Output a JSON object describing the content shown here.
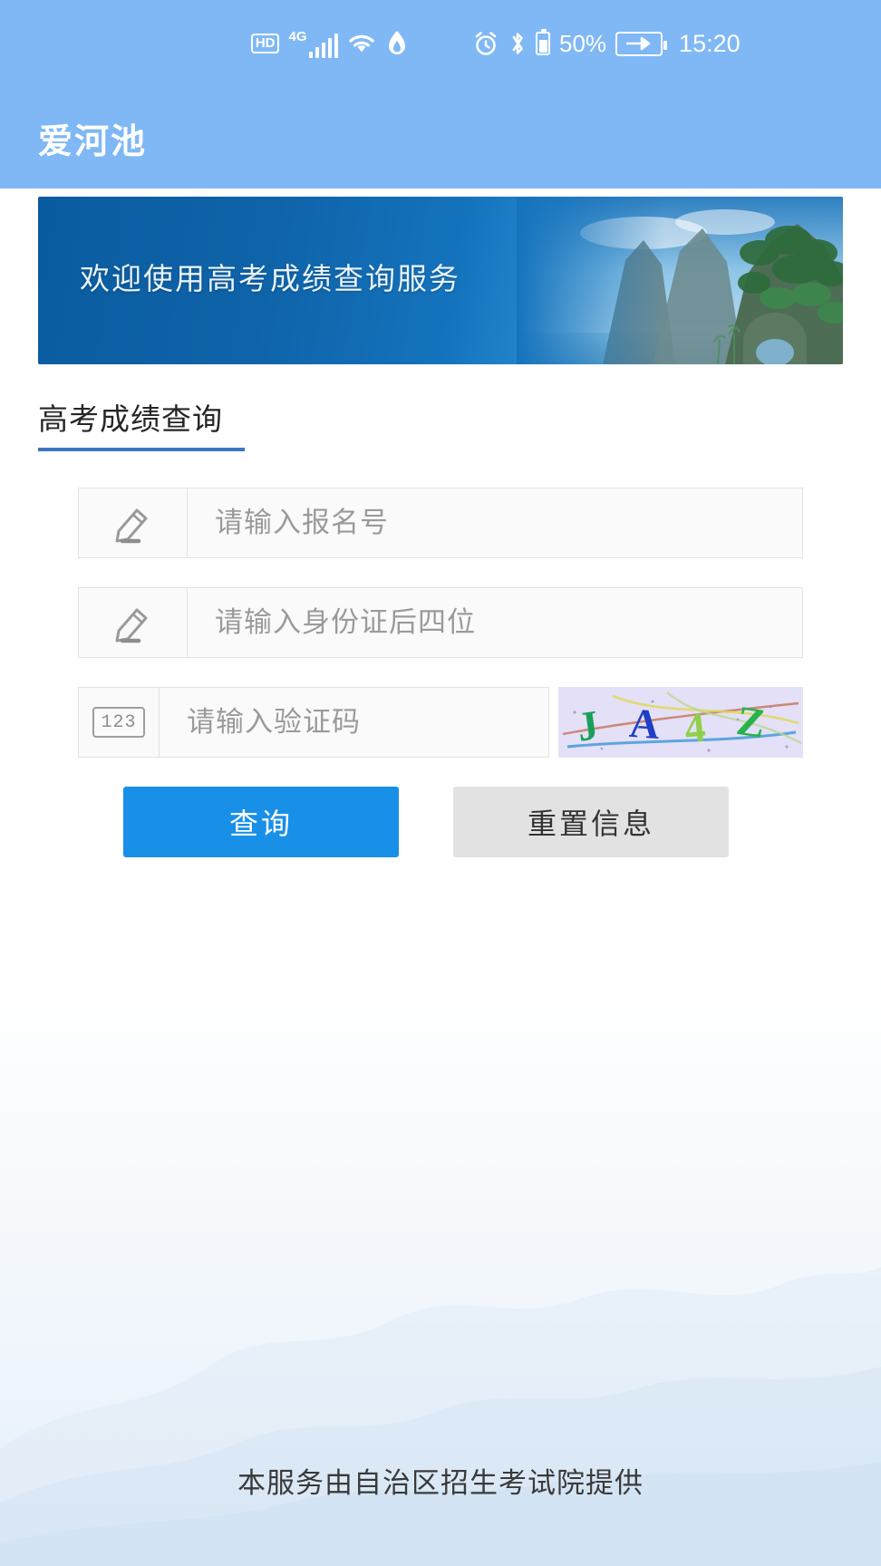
{
  "status_bar": {
    "hd_label": "HD",
    "network_label": "4G",
    "battery_percent": "50%",
    "time": "15:20",
    "icons": [
      "hd-icon",
      "signal-bars-icon",
      "wifi-icon",
      "hotspot-icon",
      "alarm-icon",
      "bluetooth-icon",
      "battery-icon",
      "charging-battery-icon"
    ]
  },
  "app_bar": {
    "title": "爱河池"
  },
  "banner": {
    "text": "欢迎使用高考成绩查询服务"
  },
  "section": {
    "tab_label": "高考成绩查询"
  },
  "form": {
    "fields": [
      {
        "icon": "pencil-icon",
        "placeholder": "请输入报名号",
        "value": ""
      },
      {
        "icon": "pencil-icon",
        "placeholder": "请输入身份证后四位",
        "value": ""
      },
      {
        "icon": "numeric-123-icon",
        "placeholder": "请输入验证码",
        "value": ""
      }
    ],
    "captcha": {
      "text": "JA4Z",
      "characters": [
        {
          "char": "J",
          "color": "#18a05a"
        },
        {
          "char": "A",
          "color": "#1f3fc4"
        },
        {
          "char": "4",
          "color": "#8fd04a"
        },
        {
          "char": "Z",
          "color": "#27b34a"
        }
      ],
      "background": "#e4e0f7"
    },
    "buttons": {
      "submit": "查询",
      "reset": "重置信息"
    }
  },
  "footer": {
    "text": "本服务由自治区招生考试院提供"
  },
  "colors": {
    "status_bar": "#7fb8f5",
    "app_bar": "#7fb8f5",
    "primary_button": "#1890e8",
    "secondary_button": "#e2e2e2",
    "tab_underline": "#3c77c4",
    "banner_gradient_start": "#0a5ca0",
    "banner_gradient_end": "#bfe0f2"
  }
}
